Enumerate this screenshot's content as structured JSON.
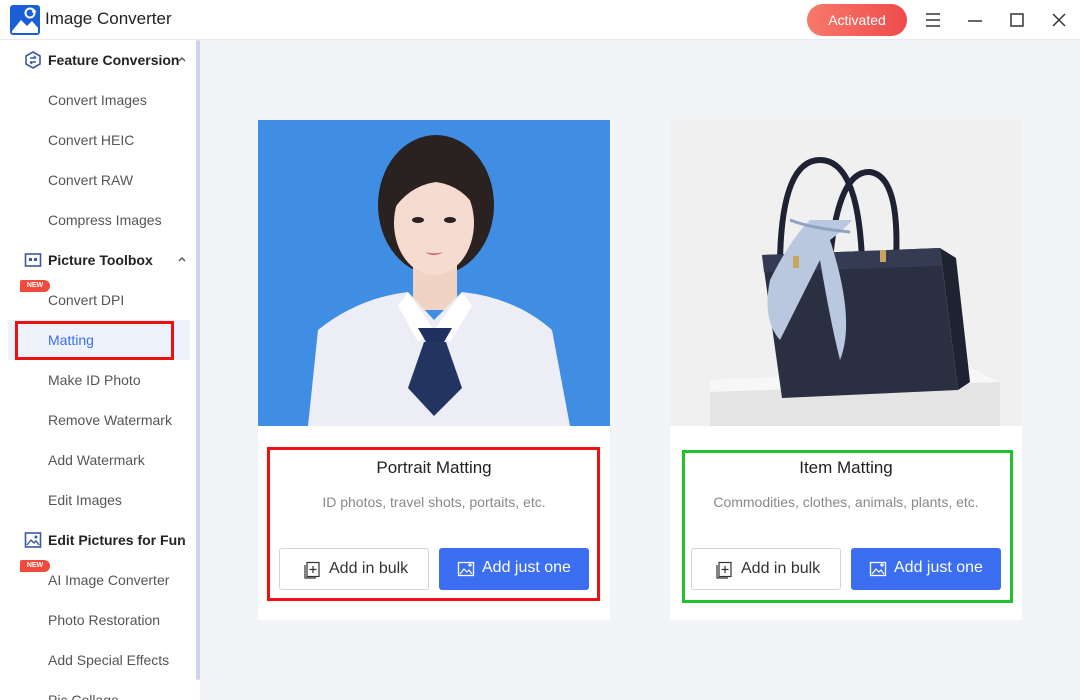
{
  "app": {
    "title": "Image Converter",
    "activated_label": "Activated"
  },
  "sidebar": {
    "groups": [
      {
        "label": "Feature Conversion",
        "icon": "swap-circle-icon",
        "items": [
          "Convert Images",
          "Convert HEIC",
          "Convert RAW",
          "Compress Images"
        ]
      },
      {
        "label": "Picture Toolbox",
        "icon": "toolbox-icon",
        "items": [
          "Convert DPI",
          "Matting",
          "Make ID Photo",
          "Remove Watermark",
          "Add Watermark",
          "Edit Images"
        ]
      },
      {
        "label": "Edit Pictures for Fun",
        "icon": "picture-edit-icon",
        "items": [
          "AI Image Converter",
          "Photo Restoration",
          "Add Special Effects",
          "Pic Collage"
        ]
      }
    ],
    "new_badge": "NEW",
    "active_item": "Matting"
  },
  "cards": [
    {
      "title": "Portrait Matting",
      "description": "ID photos, travel shots, portaits, etc.",
      "bulk_label": "Add in bulk",
      "one_label": "Add just one"
    },
    {
      "title": "Item Matting",
      "description": "Commodities, clothes, animals, plants, etc.",
      "bulk_label": "Add in bulk",
      "one_label": "Add just one"
    }
  ],
  "colors": {
    "accent": "#3c6ef2",
    "activated": "#ef4b4b",
    "highlight_red": "#ee1111",
    "highlight_green": "#22c22e"
  }
}
